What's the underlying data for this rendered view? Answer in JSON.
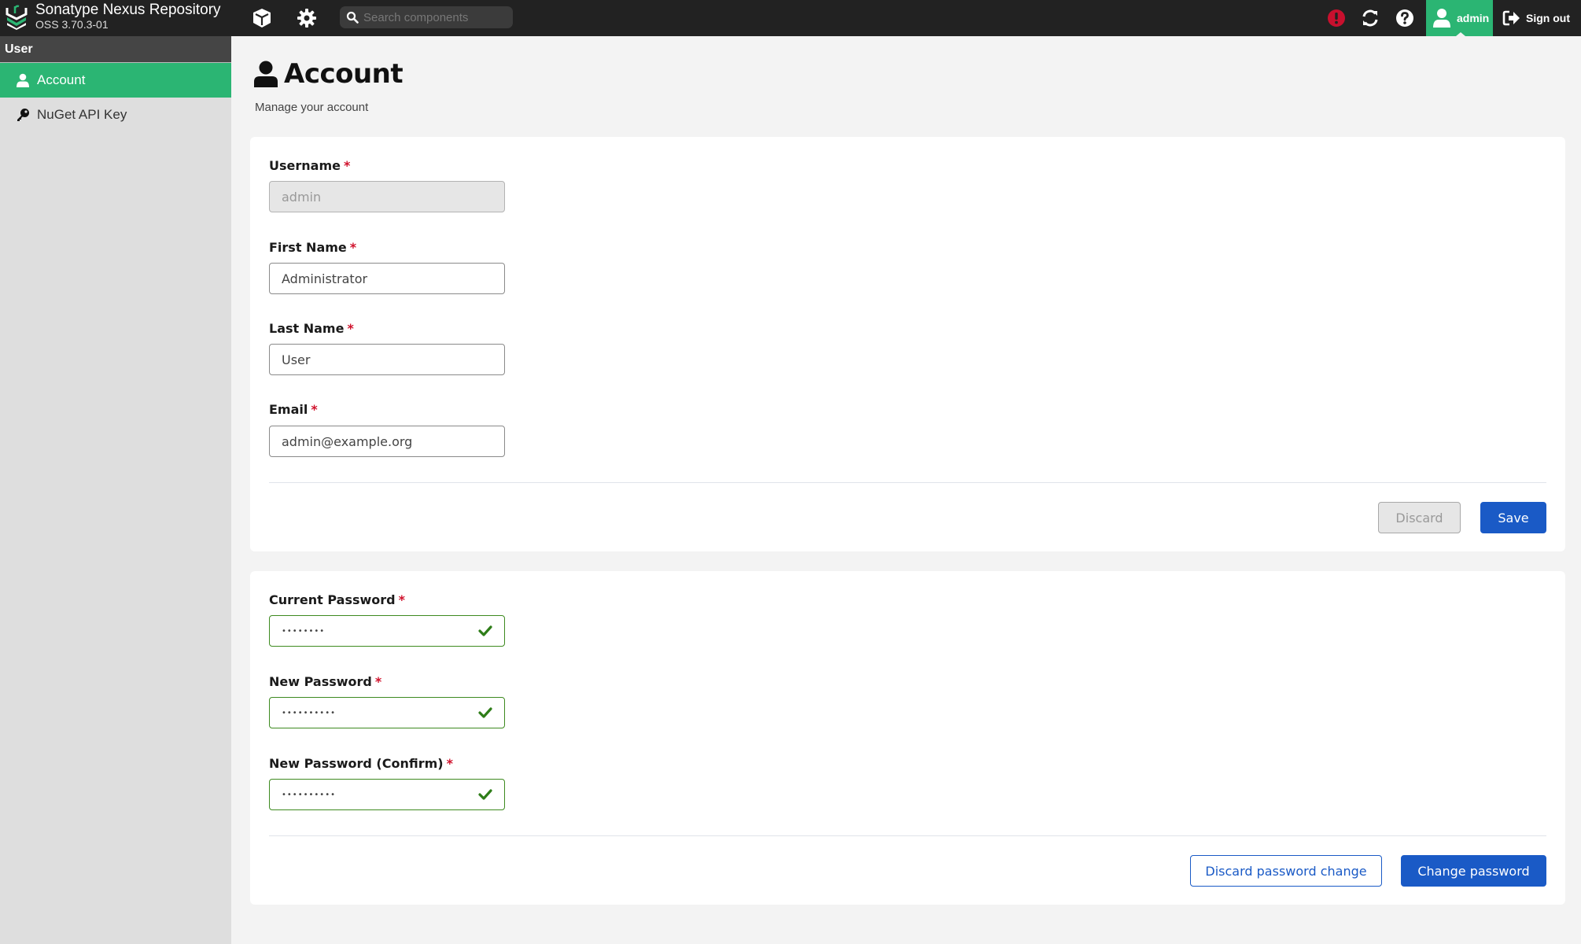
{
  "header": {
    "app_name": "Sonatype Nexus Repository",
    "version": "OSS 3.70.3-01",
    "search_placeholder": "Search components",
    "search_value": "",
    "user_label": "admin",
    "sign_out_label": "Sign out",
    "icons": [
      "browse-cube-icon",
      "settings-gear-icon",
      "search-icon",
      "alert-icon",
      "refresh-icon",
      "help-icon",
      "user-icon",
      "sign-out-icon"
    ]
  },
  "sidebar": {
    "section_title": "User",
    "items": [
      {
        "label": "Account",
        "icon": "user-icon",
        "active": true
      },
      {
        "label": "NuGet API Key",
        "icon": "key-icon",
        "active": false
      }
    ]
  },
  "page": {
    "title": "Account",
    "subtitle": "Manage your account"
  },
  "account_form": {
    "fields": [
      {
        "label": "Username",
        "required": "*",
        "value": "admin",
        "disabled": true
      },
      {
        "label": "First Name",
        "required": "*",
        "value": "Administrator"
      },
      {
        "label": "Last Name",
        "required": "*",
        "value": "User"
      },
      {
        "label": "Email",
        "required": "*",
        "value": "admin@example.org"
      }
    ],
    "discard_label": "Discard",
    "save_label": "Save"
  },
  "password_form": {
    "fields": [
      {
        "label": "Current Password",
        "required": "*",
        "value": "••••••••",
        "valid": true
      },
      {
        "label": "New Password",
        "required": "*",
        "value": "••••••••••",
        "valid": true
      },
      {
        "label": "New Password (Confirm)",
        "required": "*",
        "value": "••••••••••",
        "valid": true
      }
    ],
    "discard_label": "Discard password change",
    "change_label": "Change password"
  },
  "colors": {
    "brand_green": "#2bb573",
    "primary_blue": "#1a5ac6",
    "required_red": "#d0112b",
    "valid_green": "#3d8a1f",
    "alert_red": "#c8102e"
  }
}
